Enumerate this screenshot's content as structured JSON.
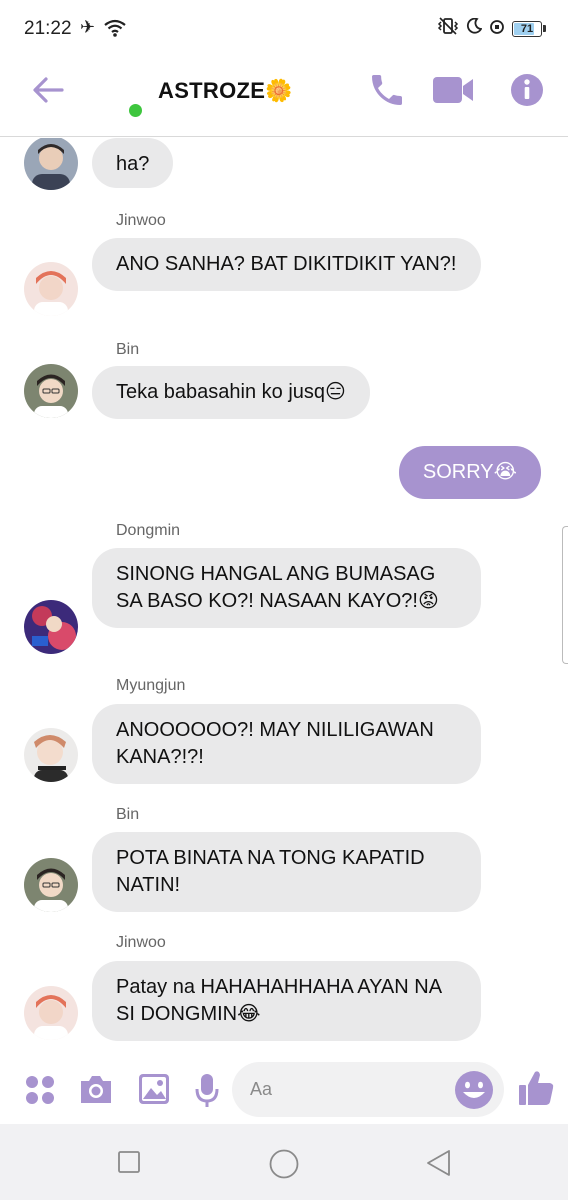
{
  "status_bar": {
    "time": "21:22",
    "battery": "71",
    "icons": [
      "airplane-mode-icon",
      "wifi-icon",
      "vibrate-icon",
      "moon-icon",
      "alarm-icon",
      "battery-icon"
    ]
  },
  "header": {
    "title": "ASTROZE🌼",
    "online": true,
    "icons": [
      "back-arrow-icon",
      "phone-icon",
      "video-camera-icon",
      "info-icon"
    ]
  },
  "messages": [
    {
      "sender": "",
      "text": "ha?",
      "outgoing": false
    },
    {
      "sender": "Jinwoo",
      "text": "ANO SANHA? BAT DIKITDIKIT YAN?!",
      "outgoing": false
    },
    {
      "sender": "Bin",
      "text": "Teka babasahin ko jusq😑",
      "outgoing": false
    },
    {
      "sender": "",
      "text": "SORRY😭",
      "outgoing": true
    },
    {
      "sender": "Dongmin",
      "text": "SINONG HANGAL ANG BUMASAG SA BASO KO?! NASAAN KAYO?!😡",
      "outgoing": false
    },
    {
      "sender": "Myungjun",
      "text": "ANOOOOOO?! MAY NILILIGAWAN KANA?!?!",
      "outgoing": false
    },
    {
      "sender": "Bin",
      "text": "POTA BINATA NA TONG KAPATID NATIN!",
      "outgoing": false
    },
    {
      "sender": "Jinwoo",
      "text": "Patay na HAHAHAHHAHA AYAN NA SI DONGMIN😂",
      "outgoing": false
    }
  ],
  "composer": {
    "placeholder": "Aa",
    "icons": [
      "apps-grid-icon",
      "camera-icon",
      "gallery-icon",
      "microphone-icon",
      "emoji-icon",
      "thumbs-up-icon"
    ]
  },
  "colors": {
    "accent": "#a793cf",
    "incoming_bubble": "#e9e9ea",
    "online": "#3ec63e"
  }
}
